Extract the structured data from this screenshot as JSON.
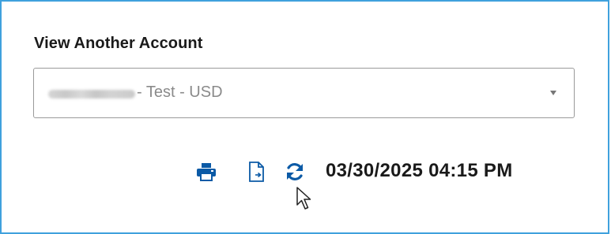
{
  "account_switcher": {
    "title": "View Another Account",
    "selected_value": "- Test - USD",
    "selected_value_redacted_prefix": true
  },
  "toolbar": {
    "print_icon": "print-icon",
    "export_icon": "export-document-icon",
    "refresh_icon": "refresh-icon",
    "timestamp": "03/30/2025 04:15 PM"
  },
  "colors": {
    "border_accent": "#3fa1dd",
    "icon_blue": "#0b5aa6",
    "text_dark": "#1a1a1a",
    "text_muted": "#8a8a8a"
  }
}
